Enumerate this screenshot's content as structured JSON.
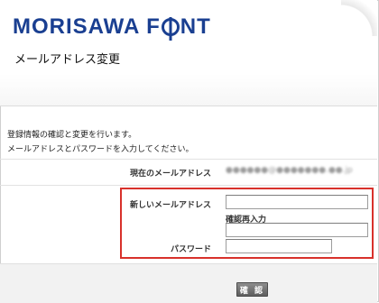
{
  "header": {
    "logo_text_left": "MORISAWA F",
    "logo_text_right": "NT",
    "page_title": "メールアドレス変更"
  },
  "intro": {
    "line1": "登録情報の確認と変更を行います。",
    "line2": "メールアドレスとパスワードを入力してください。"
  },
  "form": {
    "current_email_label": "現在のメールアドレス",
    "current_email_value": "●●●●●●@●●●●●●●.●●.jp",
    "new_email_label": "新しいメールアドレス",
    "new_email_value": "",
    "reenter_label": "確認再入力",
    "reenter_value": "",
    "password_label": "パスワード",
    "password_value": ""
  },
  "actions": {
    "confirm_label": "確 認"
  },
  "colors": {
    "brand": "#1a3f91",
    "highlight": "#d8312b"
  }
}
